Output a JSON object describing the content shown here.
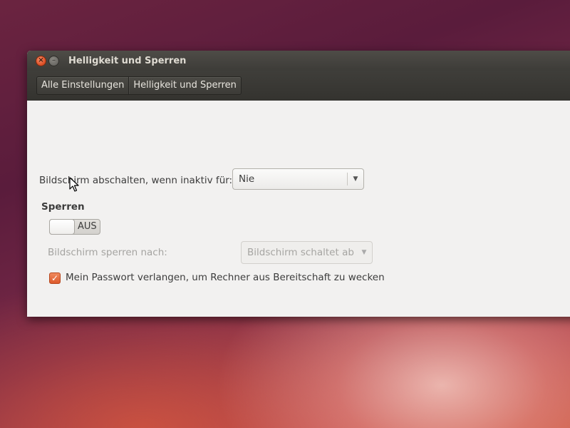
{
  "window": {
    "title": "Helligkeit und Sperren",
    "close_symbol": "×",
    "minimize_symbol": "–"
  },
  "breadcrumbs": [
    {
      "label": "Alle Einstellungen"
    },
    {
      "label": "Helligkeit und Sperren"
    }
  ],
  "screen_off": {
    "label": "Bildschirm abschalten, wenn inaktiv für:",
    "value": "Nie",
    "arrow": "▼"
  },
  "lock": {
    "heading": "Sperren",
    "switch_state": "AUS",
    "lock_after_label": "Bildschirm sperren nach:",
    "lock_after_value": "Bildschirm schaltet ab",
    "arrow": "▼"
  },
  "password": {
    "label": "Mein Passwort verlangen, um Rechner aus Bereitschaft zu wecken",
    "checked": true,
    "check_symbol": "✓"
  },
  "colors": {
    "accent": "#dd5a2b",
    "titlebar": "#3d3c38",
    "window_bg": "#f2f1f0"
  },
  "icons": [
    "close-icon",
    "minimize-icon",
    "chevron-down-icon",
    "checkmark-icon",
    "mouse-pointer-icon"
  ]
}
